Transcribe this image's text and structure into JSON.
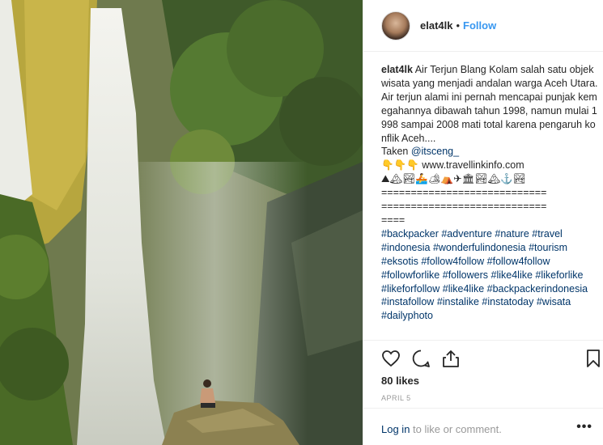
{
  "post": {
    "username": "elat4lk",
    "follow_label": "Follow",
    "dot": "•"
  },
  "caption": {
    "username": "elat4lk",
    "text": "Air Terjun Blang Kolam salah satu objek wisata yang menjadi andalan warga Aceh Utara. Air terjun alami ini pernah mencapai punjak kemegahannya dibawah tahun 1998, namun mulai 1998 sampai 2008 mati total karena pengaruh konflik Aceh....",
    "taken_prefix": "Taken ",
    "taken_mention": "@itsceng_",
    "website_emoji": "👇👇👇",
    "website": "www.travellinkinfo.com",
    "emoji_row": "⛰🏔🏞🚣🏕⛺✈🏛🏞🏔⚓🏞",
    "separator1": "============================",
    "separator2": "============================",
    "separator3": "====",
    "hashtags": [
      "#backpacker",
      "#adventure",
      "#nature",
      "#travel",
      "#indonesia",
      "#wonderfulindonesia",
      "#tourism",
      "#eksotis",
      "#follow4follow",
      "#follow4follow",
      "#followforlike",
      "#followers",
      "#like4like",
      "#likeforlike",
      "#likeforfollow",
      "#like4like",
      "#backpackerindonesia",
      "#instafollow",
      "#instalike",
      "#instatoday",
      "#wisata",
      "#dailyphoto"
    ]
  },
  "stats": {
    "likes": "80 likes",
    "date": "APRIL 5"
  },
  "footer": {
    "login_link": "Log in",
    "login_text": " to like or comment.",
    "more": "•••"
  },
  "icons": {
    "like": "heart-icon",
    "comment": "comment-icon",
    "share": "share-icon",
    "save": "bookmark-icon"
  }
}
